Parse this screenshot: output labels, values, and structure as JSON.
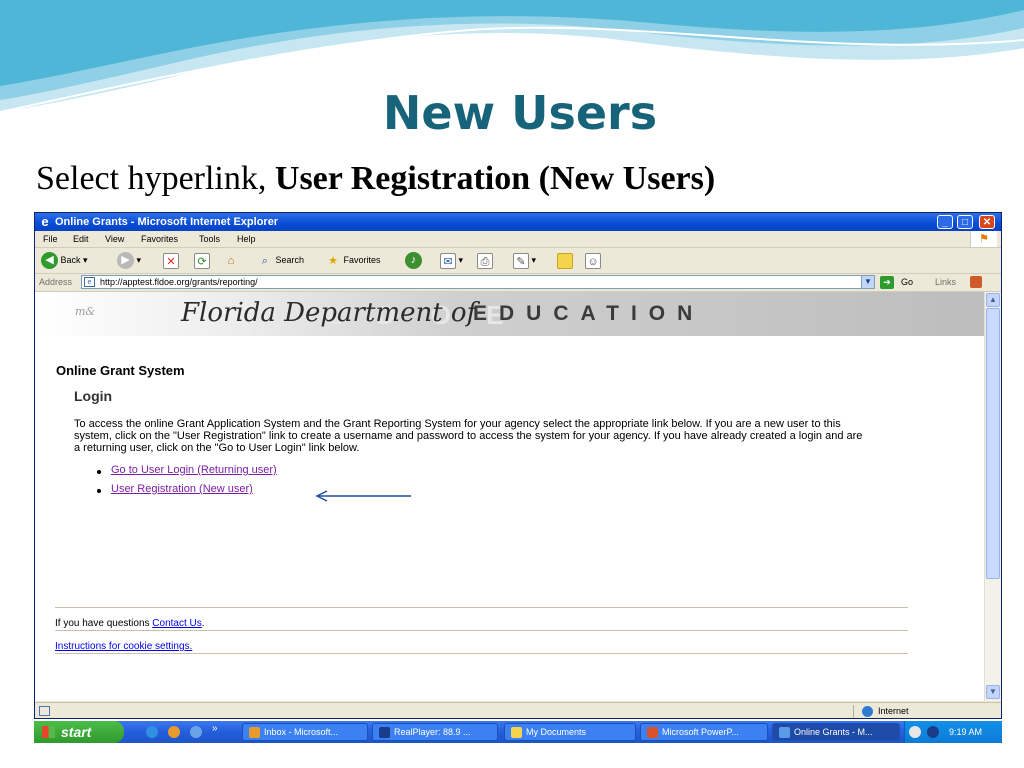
{
  "slide": {
    "title": "New Users",
    "subtitle_plain": "Select hyperlink, ",
    "subtitle_bold": "User Registration (New Users)"
  },
  "window": {
    "title": "Online Grants - Microsoft Internet Explorer",
    "menu": [
      "File",
      "Edit",
      "View",
      "Favorites",
      "Tools",
      "Help"
    ],
    "toolbar": {
      "back": "Back",
      "search": "Search",
      "favorites": "Favorites"
    },
    "address_label": "Address",
    "address_url": "http://apptest.fldoe.org/grants/reporting/",
    "go_label": "Go",
    "links_label": "Links",
    "status_zone": "Internet"
  },
  "page": {
    "banner_script": "Florida Department of",
    "banner_edu": "EDUCATION",
    "system_title": "Online Grant System",
    "login_heading": "Login",
    "description": "To access the online Grant Application System and the Grant Reporting System for your agency select the appropriate link below. If you are a new user to this system, click on the \"User Registration\" link to create a username and password to access the system for your agency. If you have already created a login and are a returning user, click on the \"Go to User Login\" link below.",
    "links": {
      "login": "Go to User Login (Returning user)",
      "register": "User Registration (New user)"
    },
    "questions_text": "If you have questions ",
    "contact_link": "Contact Us",
    "questions_end": ".",
    "cookie_link": "Instructions for cookie settings."
  },
  "taskbar": {
    "start": "start",
    "tasks": [
      "Inbox - Microsoft...",
      "RealPlayer: 88.9 ...",
      "My Documents",
      "Microsoft PowerP...",
      "Online Grants - M..."
    ],
    "clock": "9:19 AM"
  },
  "colors": {
    "title": "#17647a",
    "link_visited": "#7b1fa2",
    "annotation_arrow": "#1f4fa0"
  }
}
